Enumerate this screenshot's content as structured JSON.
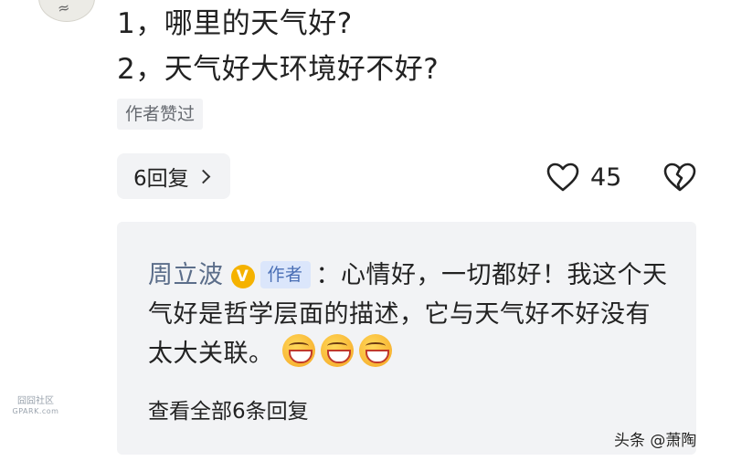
{
  "comment": {
    "lines": [
      "1，哪里的天气好?",
      "2，天气好大环境好不好?"
    ],
    "author_liked_label": "作者赞过",
    "replies_button_label": "6回复",
    "like_count": "45"
  },
  "reply": {
    "author": "周立波",
    "verified_badge": "V",
    "author_tag": "作者",
    "text": "：心情好，一切都好！我这个天气好是哲学层面的描述，它与天气好不好没有太大关联。",
    "emoji_count": 3,
    "view_all_label": "查看全部6条回复"
  },
  "watermarks": {
    "left_main": "囧囧社区",
    "left_sub": "GPARK.com",
    "right": "头条 @萧陶"
  },
  "colors": {
    "panel_bg": "#f2f3f5",
    "author_name": "#5c6e8a",
    "author_tag_bg": "#dbe6fb",
    "verified_badge": "#f5b200"
  }
}
